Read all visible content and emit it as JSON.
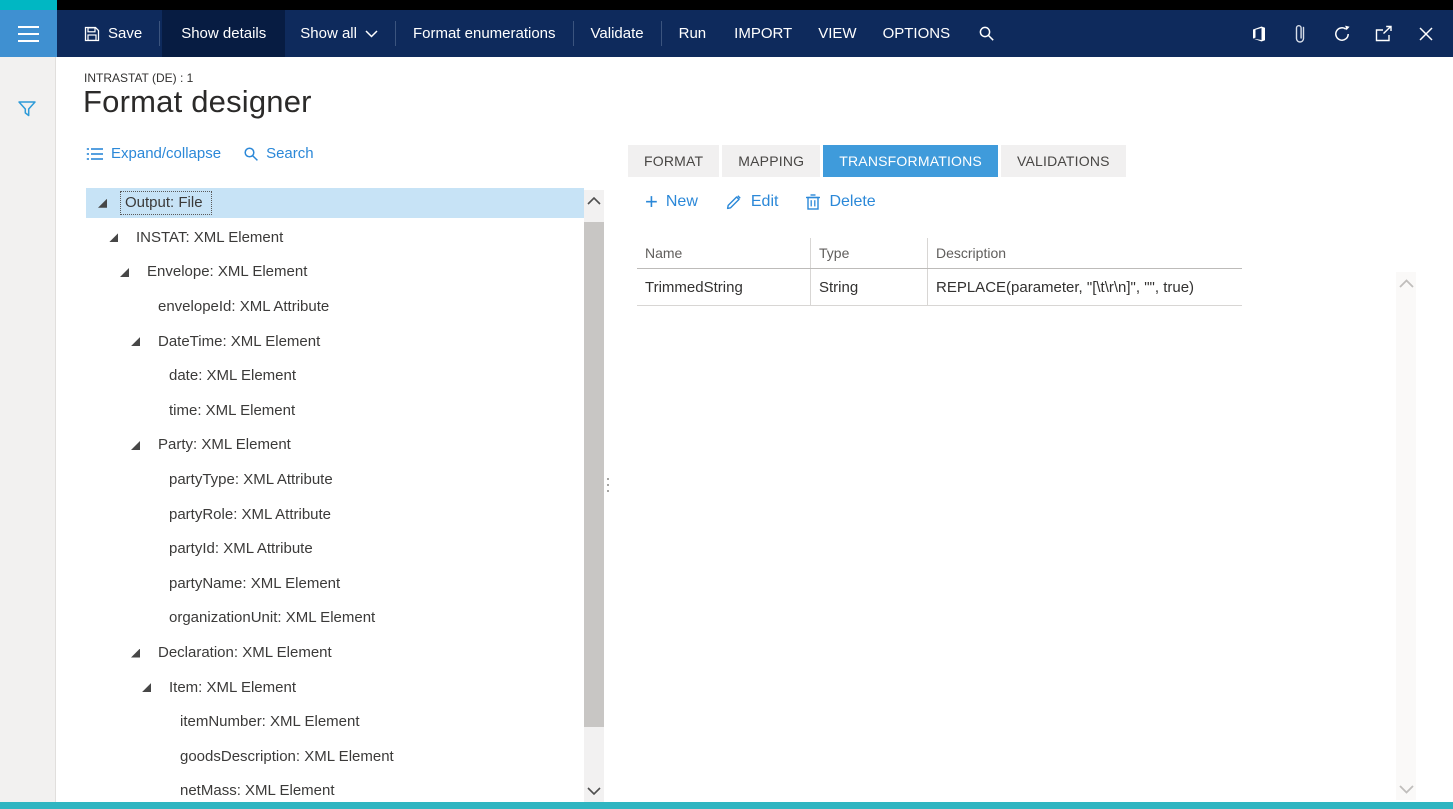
{
  "colors": {
    "toolbar_navy": "#0E2A5C",
    "toolbar_pressed": "#071C42",
    "hamburger_blue": "#3F90D1",
    "teal_accent": "#00B7C3",
    "bottom_bar_teal": "#2FB5C1",
    "accent_blue": "#2B88D8",
    "active_tab_blue": "#3F9BDB",
    "selected_row_blue": "#C7E3F6"
  },
  "chrome": {
    "toolbar": {
      "save": "Save",
      "show_details": "Show details",
      "show_all": "Show all",
      "format_enumerations": "Format enumerations",
      "validate": "Validate",
      "run": "Run",
      "import_menu": "IMPORT",
      "view_menu": "VIEW",
      "options_menu": "OPTIONS"
    },
    "icons": {
      "hamburger": "hamburger-icon",
      "save": "floppy-disk-icon",
      "show_all_chevron": "chevron-down-icon",
      "search": "search-icon",
      "window_icons": [
        "office-logo-icon",
        "attach-icon",
        "refresh-icon",
        "open-in-new-window-icon",
        "close-icon"
      ],
      "sidebar_filter": "filter-funnel-icon"
    }
  },
  "page": {
    "breadcrumb": "INTRASTAT (DE) : 1",
    "title": "Format designer"
  },
  "tree_toolbar": {
    "expand_collapse": "Expand/collapse",
    "search": "Search"
  },
  "tree": {
    "items": [
      {
        "label": "Output: File",
        "level": 0,
        "expandable": true,
        "selected": true
      },
      {
        "label": "INSTAT: XML Element",
        "level": 1,
        "expandable": true,
        "selected": false
      },
      {
        "label": "Envelope: XML Element",
        "level": 2,
        "expandable": true,
        "selected": false
      },
      {
        "label": "envelopeId: XML Attribute",
        "level": 3,
        "expandable": false,
        "selected": false
      },
      {
        "label": "DateTime: XML Element",
        "level": 3,
        "expandable": true,
        "selected": false
      },
      {
        "label": "date: XML Element",
        "level": 4,
        "expandable": false,
        "selected": false
      },
      {
        "label": "time: XML Element",
        "level": 4,
        "expandable": false,
        "selected": false
      },
      {
        "label": "Party: XML Element",
        "level": 3,
        "expandable": true,
        "selected": false
      },
      {
        "label": "partyType: XML Attribute",
        "level": 4,
        "expandable": false,
        "selected": false
      },
      {
        "label": "partyRole: XML Attribute",
        "level": 4,
        "expandable": false,
        "selected": false
      },
      {
        "label": "partyId: XML Attribute",
        "level": 4,
        "expandable": false,
        "selected": false
      },
      {
        "label": "partyName: XML Element",
        "level": 4,
        "expandable": false,
        "selected": false
      },
      {
        "label": "organizationUnit: XML Element",
        "level": 4,
        "expandable": false,
        "selected": false
      },
      {
        "label": "Declaration: XML Element",
        "level": 3,
        "expandable": true,
        "selected": false
      },
      {
        "label": "Item: XML Element",
        "level": 4,
        "expandable": true,
        "selected": false
      },
      {
        "label": "itemNumber: XML Element",
        "level": 5,
        "expandable": false,
        "selected": false
      },
      {
        "label": "goodsDescription: XML Element",
        "level": 5,
        "expandable": false,
        "selected": false
      },
      {
        "label": "netMass: XML Element",
        "level": 5,
        "expandable": false,
        "selected": false
      }
    ]
  },
  "detail": {
    "tabs": [
      {
        "label": "FORMAT",
        "active": false
      },
      {
        "label": "MAPPING",
        "active": false
      },
      {
        "label": "TRANSFORMATIONS",
        "active": true
      },
      {
        "label": "VALIDATIONS",
        "active": false
      }
    ],
    "actions": {
      "new_label": "New",
      "edit_label": "Edit",
      "delete_label": "Delete"
    },
    "table": {
      "columns": [
        "Name",
        "Type",
        "Description"
      ],
      "rows": [
        [
          "TrimmedString",
          "String",
          "REPLACE(parameter, \"[\\t\\r\\n]\", \"\", true)"
        ]
      ]
    }
  }
}
